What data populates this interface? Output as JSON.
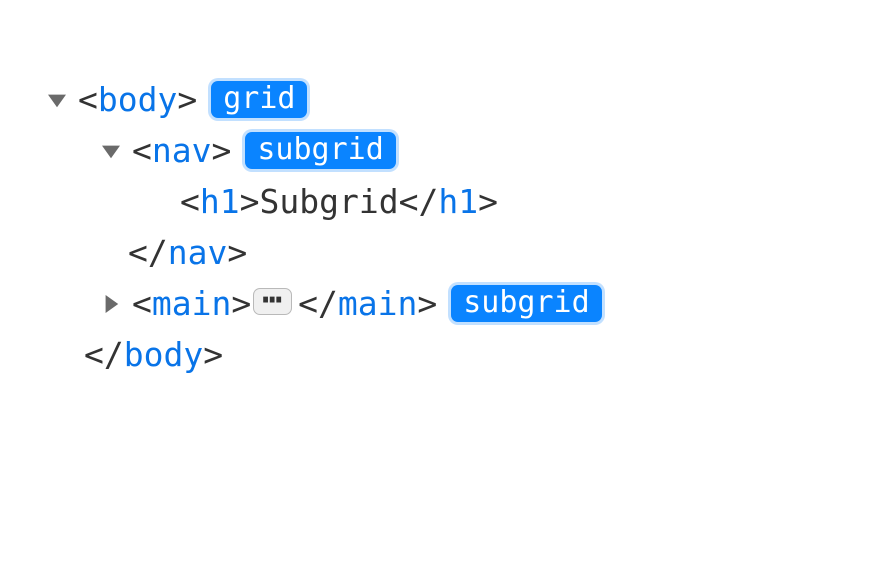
{
  "tree": {
    "body": {
      "tag_open_prefix": "<",
      "tag_name": "body",
      "tag_open_suffix": ">",
      "tag_close_prefix": "</",
      "tag_close_suffix": ">",
      "badge": "grid"
    },
    "nav": {
      "tag_open_prefix": "<",
      "tag_name": "nav",
      "tag_open_suffix": ">",
      "tag_close_prefix": "</",
      "tag_close_suffix": ">",
      "badge": "subgrid"
    },
    "h1": {
      "tag_open_prefix": "<",
      "tag_name": "h1",
      "tag_open_suffix": ">",
      "tag_close_prefix": "</",
      "tag_close_suffix": ">",
      "text": "Subgrid"
    },
    "main": {
      "tag_open_prefix": "<",
      "tag_name": "main",
      "tag_open_suffix": ">",
      "tag_close_prefix": "</",
      "tag_close_suffix": ">",
      "ellipsis": "⋯",
      "badge": "subgrid"
    }
  }
}
